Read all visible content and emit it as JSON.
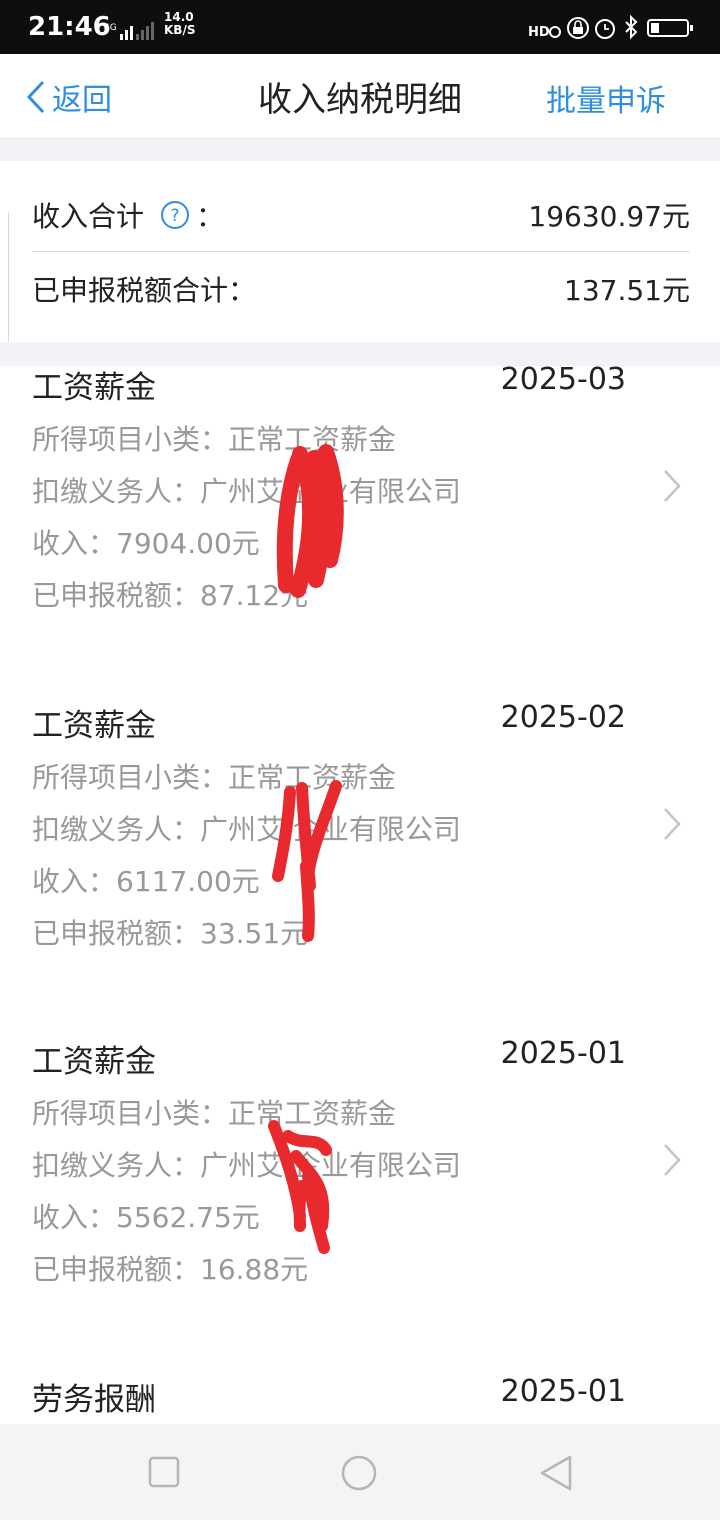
{
  "status_bar": {
    "time": "21:46",
    "network": "4G",
    "speed_value": "14.0",
    "speed_unit": "KB/S",
    "hd_label": "HD"
  },
  "header": {
    "back_label": "返回",
    "title": "收入纳税明细",
    "action_label": "批量申诉"
  },
  "summary": {
    "income_label": "收入合计",
    "colon": "：",
    "income_value": "19630.97元",
    "tax_label": "已申报税额合计：",
    "tax_value": "137.51元"
  },
  "records": [
    {
      "title": "工资薪金",
      "date": "2025-03",
      "subcategory": "所得项目小类：正常工资薪金",
      "payer": "扣缴义务人：广州艾  企业有限公司",
      "income": "收入：7904.00元",
      "tax": "已申报税额：87.12元"
    },
    {
      "title": "工资薪金",
      "date": "2025-02",
      "subcategory": "所得项目小类：正常工资薪金",
      "payer": "扣缴义务人：广州艾  企业有限公司",
      "income": "收入：6117.00元",
      "tax": "已申报税额：33.51元"
    },
    {
      "title": "工资薪金",
      "date": "2025-01",
      "subcategory": "所得项目小类：正常工资薪金",
      "payer": "扣缴义务人：广州艾  企业有限公司",
      "income": "收入：5562.75元",
      "tax": "已申报税额：16.88元"
    },
    {
      "title": "劳务报酬",
      "date": "2025-01"
    }
  ],
  "icons": {
    "back": "chevron-left-icon",
    "help": "question-circle-icon",
    "row_arrow": "chevron-right-icon",
    "nav_recent": "square-icon",
    "nav_home": "circle-icon",
    "nav_back": "triangle-icon"
  },
  "colors": {
    "accent": "#2f8ee0",
    "redaction": "#e8292e",
    "status_bar": "#0e0e0e",
    "secondary_text": "#999999"
  }
}
